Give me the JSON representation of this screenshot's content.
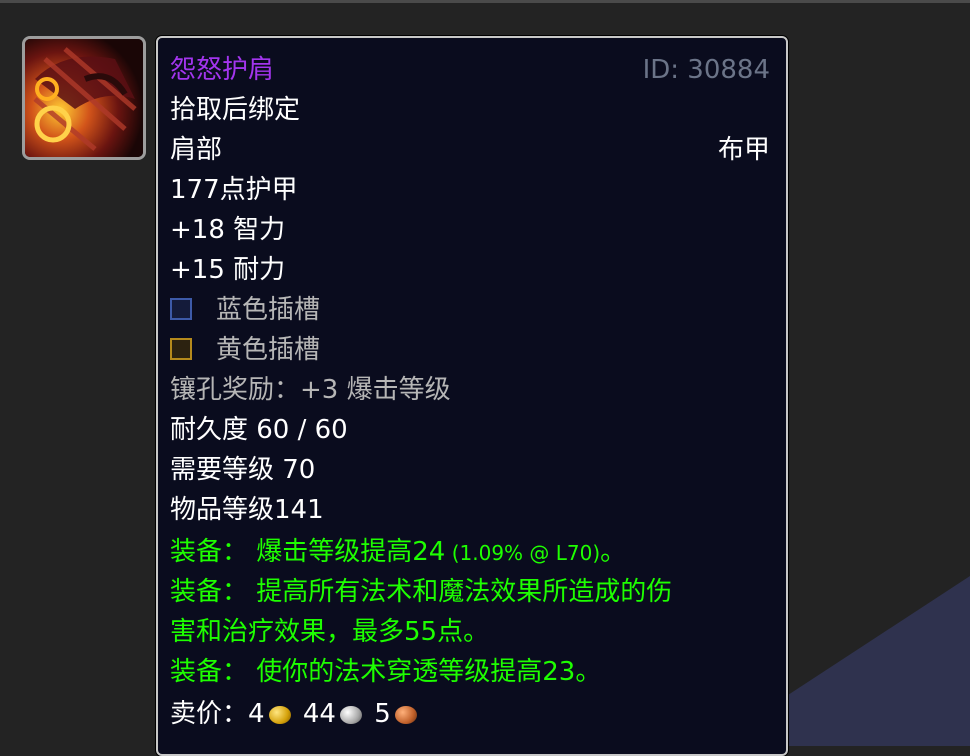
{
  "item": {
    "name": "怨怒护肩",
    "id_text": "ID: 30884",
    "bind": "拾取后绑定",
    "slot": "肩部",
    "armor_type": "布甲",
    "armor": "177点护甲",
    "stats": [
      "+18 智力",
      "+15 耐力"
    ],
    "sockets": [
      {
        "color": "blue",
        "label": "蓝色插槽",
        "icon": "blue-socket-icon"
      },
      {
        "color": "yellow",
        "label": "黄色插槽",
        "icon": "yellow-socket-icon"
      }
    ],
    "socket_bonus": "镶孔奖励：+3 爆击等级",
    "durability": "耐久度 60 / 60",
    "required_level": "需要等级 70",
    "item_level": "物品等级141",
    "equip_effects": {
      "e1_main": "装备： 爆击等级提高24",
      "e1_note": " (1.09% @ L70)",
      "e1_end": "。",
      "e2_line1": "装备： 提高所有法术和魔法效果所造成的伤",
      "e2_line2": "害和治疗效果，最多55点。",
      "e3": "装备： 使你的法术穿透等级提高23。"
    },
    "sell_price": {
      "label": "卖价：",
      "gold": "4",
      "silver": "44",
      "copper": "5"
    }
  },
  "colors": {
    "epic_name": "#a335ee",
    "equip_green": "#1eff00",
    "tooltip_bg": "#0a0c1e",
    "grey_text": "#b6b6b6"
  }
}
